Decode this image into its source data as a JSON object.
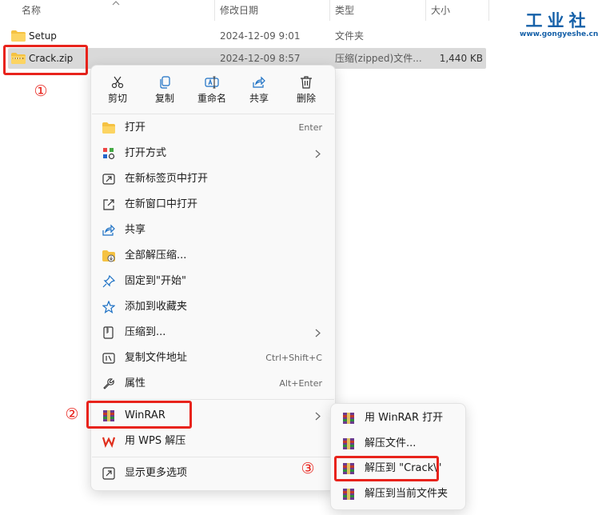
{
  "columns": {
    "name": "名称",
    "date": "修改日期",
    "type": "类型",
    "size": "大小"
  },
  "files": [
    {
      "name": "Setup",
      "date": "2024-12-09 9:01",
      "type": "文件夹",
      "size": "",
      "icon": "folder-icon"
    },
    {
      "name": "Crack.zip",
      "date": "2024-12-09 8:57",
      "type": "压缩(zipped)文件...",
      "size": "1,440 KB",
      "icon": "zip-folder-icon",
      "selected": true
    }
  ],
  "logo": {
    "title": "工业社",
    "url": "www.gongyeshe.cn"
  },
  "markers": {
    "one": "①",
    "two": "②",
    "three": "③"
  },
  "quick_actions": [
    {
      "label": "剪切",
      "icon": "scissors-icon"
    },
    {
      "label": "复制",
      "icon": "copy-icon"
    },
    {
      "label": "重命名",
      "icon": "rename-icon"
    },
    {
      "label": "共享",
      "icon": "share-icon"
    },
    {
      "label": "删除",
      "icon": "trash-icon"
    }
  ],
  "menu_items": [
    {
      "label": "打开",
      "shortcut": "Enter",
      "icon": "open-folder-icon"
    },
    {
      "label": "打开方式",
      "shortcut": "",
      "icon": "open-with-icon",
      "submenu": true
    },
    {
      "label": "在新标签页中打开",
      "shortcut": "",
      "icon": "new-tab-icon"
    },
    {
      "label": "在新窗口中打开",
      "shortcut": "",
      "icon": "new-window-icon"
    },
    {
      "label": "共享",
      "shortcut": "",
      "icon": "share-icon"
    },
    {
      "label": "全部解压缩...",
      "shortcut": "",
      "icon": "extract-all-icon"
    },
    {
      "label": "固定到\"开始\"",
      "shortcut": "",
      "icon": "pin-icon"
    },
    {
      "label": "添加到收藏夹",
      "shortcut": "",
      "icon": "star-icon"
    },
    {
      "label": "压缩到...",
      "shortcut": "",
      "icon": "compress-icon",
      "submenu": true
    },
    {
      "label": "复制文件地址",
      "shortcut": "Ctrl+Shift+C",
      "icon": "copy-path-icon"
    },
    {
      "label": "属性",
      "shortcut": "Alt+Enter",
      "icon": "wrench-icon"
    },
    {
      "label": "WinRAR",
      "shortcut": "",
      "icon": "winrar-icon",
      "submenu": true
    },
    {
      "label": "用 WPS 解压",
      "shortcut": "",
      "icon": "wps-icon"
    },
    {
      "label": "显示更多选项",
      "shortcut": "",
      "icon": "more-options-icon"
    }
  ],
  "winrar_submenu": [
    {
      "label": "用 WinRAR 打开"
    },
    {
      "label": "解压文件..."
    },
    {
      "label": "解压到 \"Crack\\\""
    },
    {
      "label": "解压到当前文件夹"
    }
  ],
  "colors": {
    "highlight": "#e8231c",
    "logo": "#1560a8",
    "folder": "#f5c242",
    "selection": "#d9d9d9"
  }
}
